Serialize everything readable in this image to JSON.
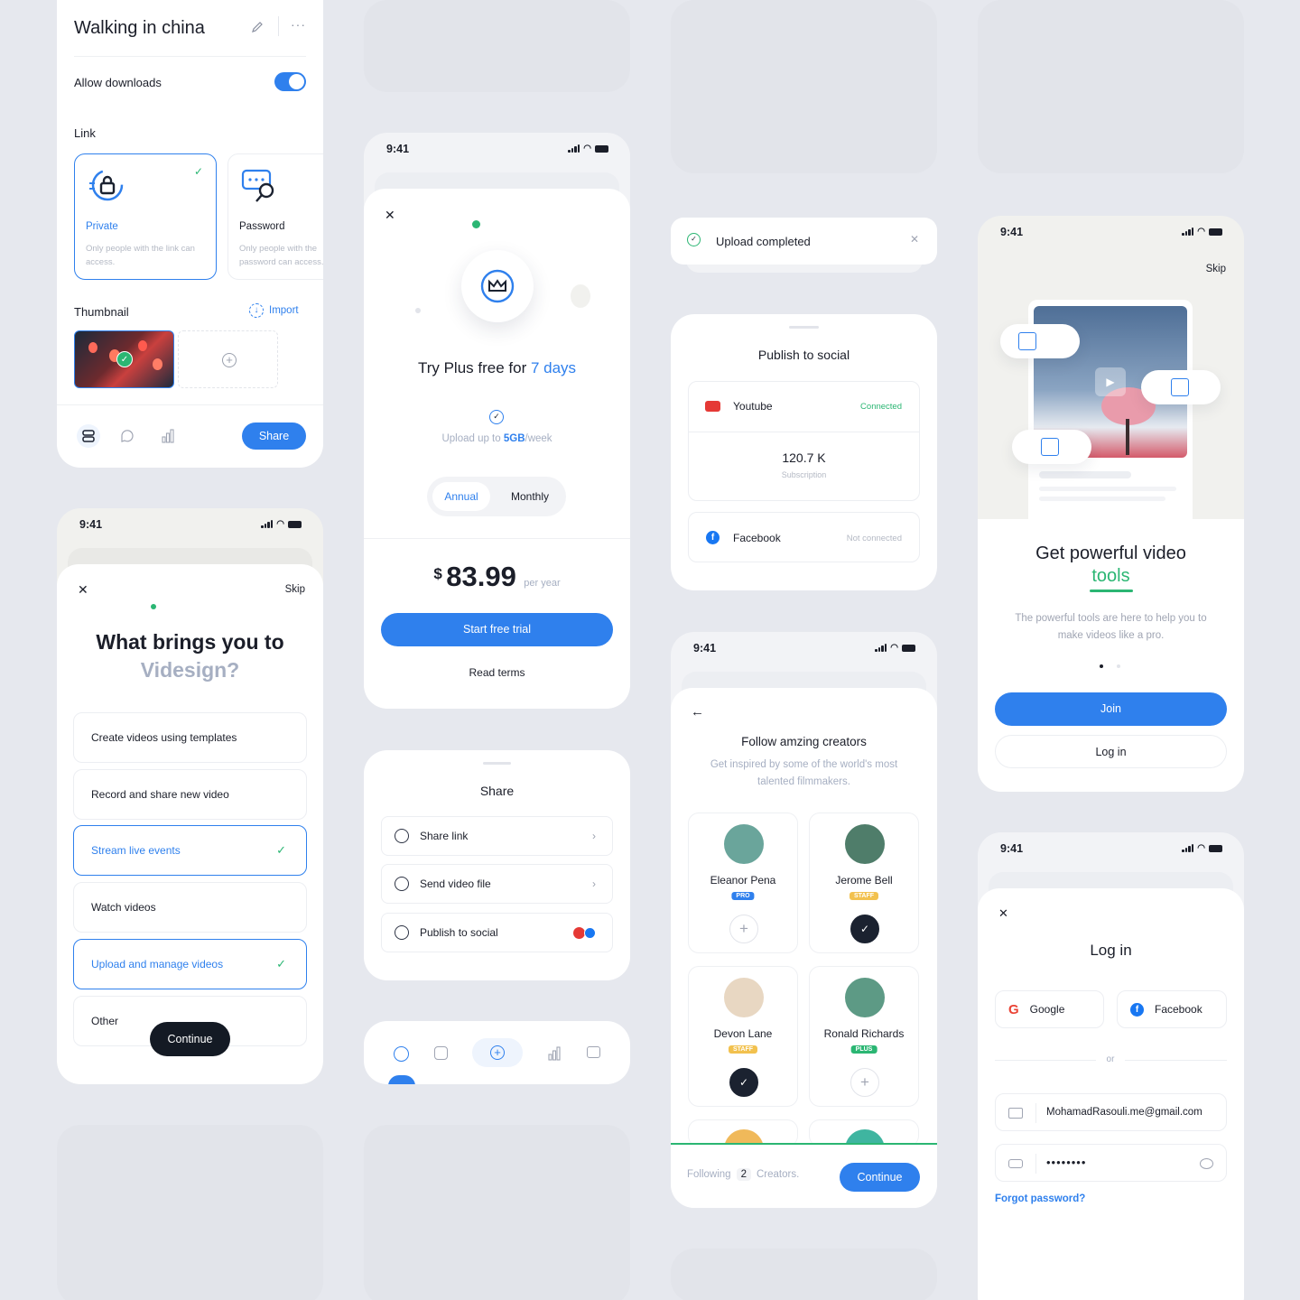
{
  "colors": {
    "primary": "#2f80ed",
    "success": "#2bb673",
    "dark": "#1b2230",
    "background": "#e6e8ee"
  },
  "share_settings": {
    "title": "Walking in china",
    "allow_downloads_label": "Allow downloads",
    "allow_downloads": true,
    "link_label": "Link",
    "options": [
      {
        "label": "Private",
        "desc": "Only people with the link can access.",
        "icon": "lock-icon",
        "selected": true
      },
      {
        "label": "Password",
        "desc": "Only people with the password can access.",
        "icon": "password-key-icon",
        "selected": false
      }
    ],
    "thumbnail_label": "Thumbnail",
    "import_label": "Import",
    "share_label": "Share"
  },
  "onboarding_question": {
    "time": "9:41",
    "skip": "Skip",
    "title_line1": "What brings you to",
    "title_line2": "Videsign?",
    "options": [
      {
        "label": "Create videos using templates",
        "selected": false
      },
      {
        "label": "Record and share new video",
        "selected": false
      },
      {
        "label": "Stream live events",
        "selected": true
      },
      {
        "label": "Watch videos",
        "selected": false
      },
      {
        "label": "Upload and manage videos",
        "selected": true
      },
      {
        "label": "Other",
        "selected": false
      }
    ],
    "continue": "Continue"
  },
  "plus_trial": {
    "time": "9:41",
    "title_prefix": "Try Plus free for ",
    "title_highlight": "7 days",
    "upload_prefix": "Upload up to ",
    "upload_highlight": "5GB",
    "upload_suffix": "/week",
    "tabs": [
      "Annual",
      "Monthly"
    ],
    "currency": "$",
    "price": "83.99",
    "period": "per year",
    "cta": "Start free trial",
    "terms": "Read terms"
  },
  "share_sheet": {
    "title": "Share",
    "items": [
      {
        "label": "Share link",
        "icon": "link-icon"
      },
      {
        "label": "Send video file",
        "icon": "video-file-icon"
      },
      {
        "label": "Publish to social",
        "icon": "rss-icon"
      }
    ]
  },
  "toast": {
    "message": "Upload completed"
  },
  "publish_social": {
    "title": "Publish to social",
    "youtube": {
      "name": "Youtube",
      "status": "Connected",
      "count": "120.7 K",
      "count_label": "Subscription"
    },
    "facebook": {
      "name": "Facebook",
      "status": "Not connected"
    }
  },
  "follow_creators": {
    "time": "9:41",
    "title": "Follow amzing creators",
    "subtitle": "Get inspired by some of the world's most talented filmmakers.",
    "creators": [
      {
        "name": "Eleanor Pena",
        "badge": "PRO",
        "badge_color": "#2f80ed",
        "following": false,
        "avatar_color": "#6aa59b"
      },
      {
        "name": "Jerome Bell",
        "badge": "STAFF",
        "badge_color": "#f2c14e",
        "following": true,
        "avatar_color": "#4f7d6a"
      },
      {
        "name": "Devon Lane",
        "badge": "STAFF",
        "badge_color": "#f2c14e",
        "following": true,
        "avatar_color": "#e8d7c2"
      },
      {
        "name": "Ronald Richards",
        "badge": "PLUS",
        "badge_color": "#2bb673",
        "following": false,
        "avatar_color": "#5d9a85"
      }
    ],
    "footer_prefix": "Following",
    "footer_count": "2",
    "footer_suffix": "Creators.",
    "continue": "Continue"
  },
  "video_tools": {
    "time": "9:41",
    "skip": "Skip",
    "title_line1": "Get powerful video",
    "title_line2": "tools",
    "description": "The powerful tools are here to help you to make videos like a pro.",
    "join": "Join",
    "login": "Log in"
  },
  "login": {
    "time": "9:41",
    "title": "Log in",
    "google": "Google",
    "facebook": "Facebook",
    "or": "or",
    "email": "MohamadRasouli.me@gmail.com",
    "password": "••••••••",
    "forgot": "Forgot password?"
  }
}
